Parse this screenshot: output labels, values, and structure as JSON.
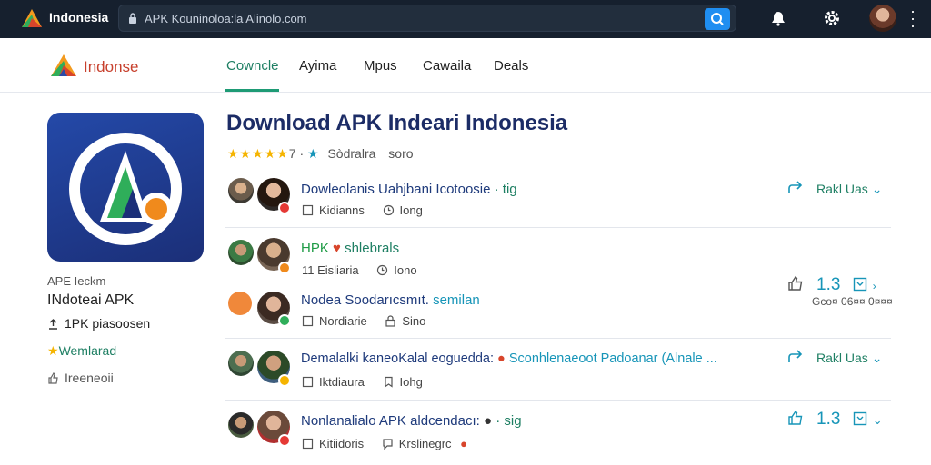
{
  "topbar": {
    "brand": "Indonesia",
    "url": "APK Kouninoloa:la Alinolo.com",
    "icons": [
      "app-logo-icon",
      "lock-icon",
      "search-icon",
      "bell-icon",
      "gear-icon",
      "avatar",
      "more-vert-icon"
    ]
  },
  "nav": {
    "brand": "Indonse",
    "tabs": [
      {
        "label": "Cowncle"
      },
      {
        "label": "Ayima"
      },
      {
        "label": "Mpus"
      },
      {
        "label": "Cawaila"
      },
      {
        "label": "Deals"
      }
    ]
  },
  "sidebar": {
    "app_label": "APE Ieckm",
    "app_name": "INdoteai APK",
    "size": "1PK piasoosen",
    "wishlist": "Wemlarad",
    "report": "Ireeneoii"
  },
  "main": {
    "title": "Download APK Indeari Indonesia",
    "rating_stars": "★★★★★",
    "rating_value": "7",
    "rating_text": "Sòdralra",
    "rating_extra": "soro"
  },
  "rows": [
    {
      "title": "Dowleolanis Uahjbani Icotoosie",
      "tag": "· tig",
      "meta1": "Kidianns",
      "meta2": "Iong",
      "action": "Rakl Uas",
      "action_chev": "⌄"
    },
    {
      "title": "HPK",
      "tag": "shlebrals",
      "meta1": "11 Eisliaria",
      "meta2": "Iono",
      "action": "",
      "action_chev": ""
    },
    {
      "title": "Nodea Soodarıcsmıt.",
      "tag": "semilan",
      "meta1": "Nordiarie",
      "meta2": "Sino",
      "action": "1.3",
      "action_sub": "Gco¤ 06¤¤ 0¤¤¤"
    },
    {
      "title": "Demalalki kaneoKalal eoguedda:",
      "tag": "Sconhlenaeoot Padoanar (Alnale ...",
      "meta1": "Iktdiaura",
      "meta2": "Iohg",
      "action": "Rakl Uas",
      "action_chev": "⌄"
    },
    {
      "title": "Nonlanalialo APK aldcendacı:",
      "tag": "· sig",
      "meta1": "Kitiidoris",
      "meta2": "Krslinegrc",
      "action": "1.3",
      "action_chev": "⌄"
    }
  ],
  "colors": {
    "accent": "#1e9b75",
    "link": "#1e3a7b",
    "topbar": "#16202e",
    "action": "#1795b8"
  }
}
